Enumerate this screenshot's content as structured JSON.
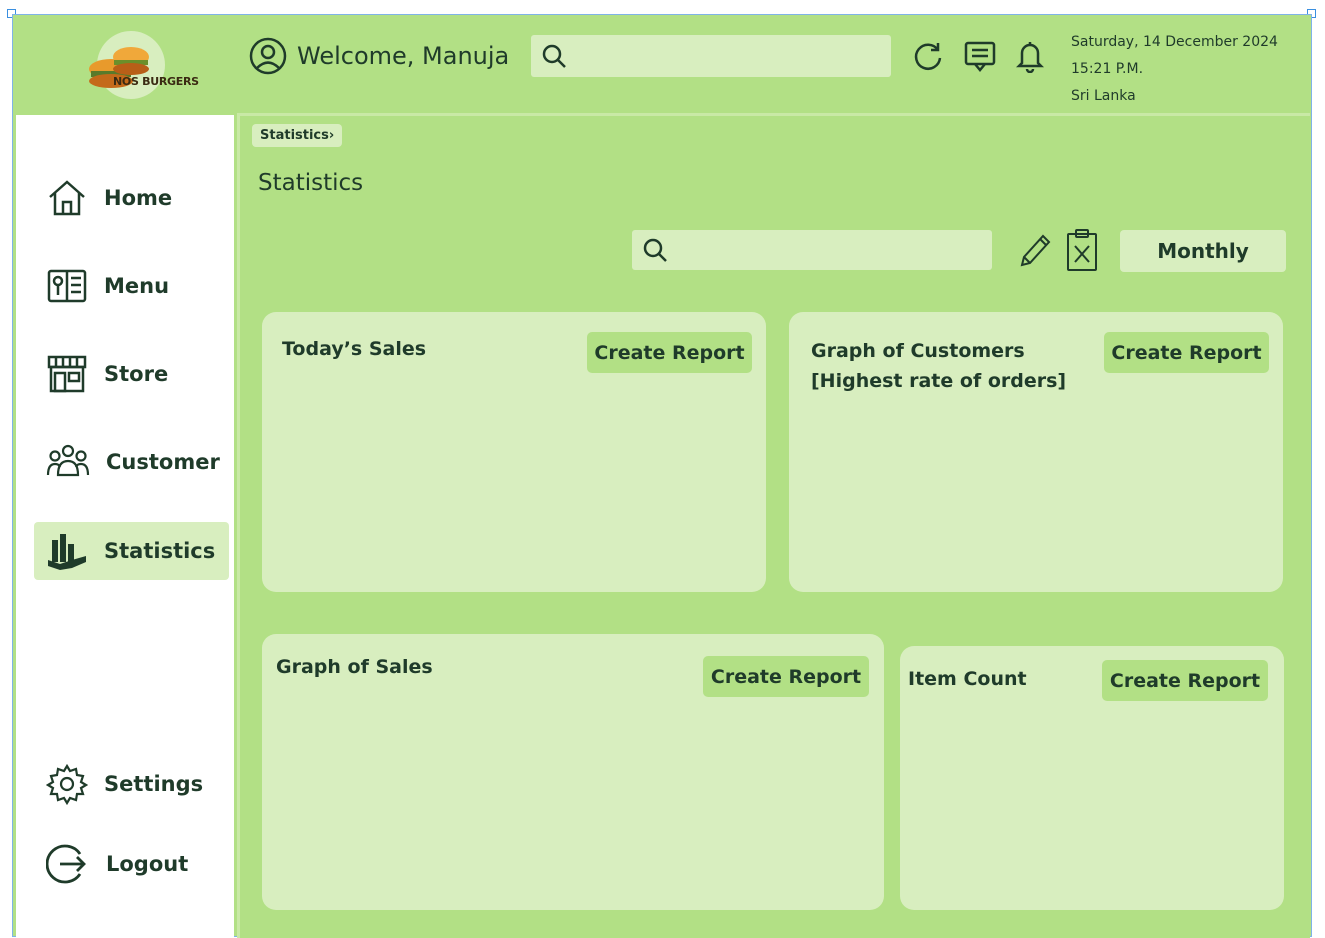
{
  "header": {
    "logo_text": "NOS BURGERS",
    "welcome": "Welcome, Manuja",
    "search": {
      "value": "",
      "placeholder": ""
    },
    "date": "Saturday, 14 December 2024",
    "time": "15:21 P.M.",
    "location": "Sri Lanka",
    "icons": [
      "refresh-icon",
      "message-icon",
      "bell-icon"
    ]
  },
  "sidebar": {
    "items": [
      {
        "label": "Home",
        "icon": "home-icon"
      },
      {
        "label": "Menu",
        "icon": "menu-book-icon"
      },
      {
        "label": "Store",
        "icon": "store-icon"
      },
      {
        "label": "Customer",
        "icon": "customers-icon"
      },
      {
        "label": "Statistics",
        "icon": "statistics-icon",
        "active": true
      }
    ],
    "bottom": [
      {
        "label": "Settings",
        "icon": "gear-icon"
      },
      {
        "label": "Logout",
        "icon": "logout-icon"
      }
    ]
  },
  "main": {
    "breadcrumb": "Statistics›",
    "title": "Statistics",
    "search": {
      "value": "",
      "placeholder": ""
    },
    "period": "Monthly",
    "cards": [
      {
        "title": "Today’s Sales",
        "button": "Create Report"
      },
      {
        "title": "Graph of Customers\n[Highest rate of orders]",
        "button": "Create Report"
      },
      {
        "title": "Graph of Sales",
        "button": "Create Report"
      },
      {
        "title": "Item Count",
        "button": "Create Report"
      }
    ]
  },
  "colors": {
    "accent": "#b2e085",
    "panel": "#d8eebf",
    "text": "#1f3b2a",
    "sidebar": "#ffffff"
  }
}
